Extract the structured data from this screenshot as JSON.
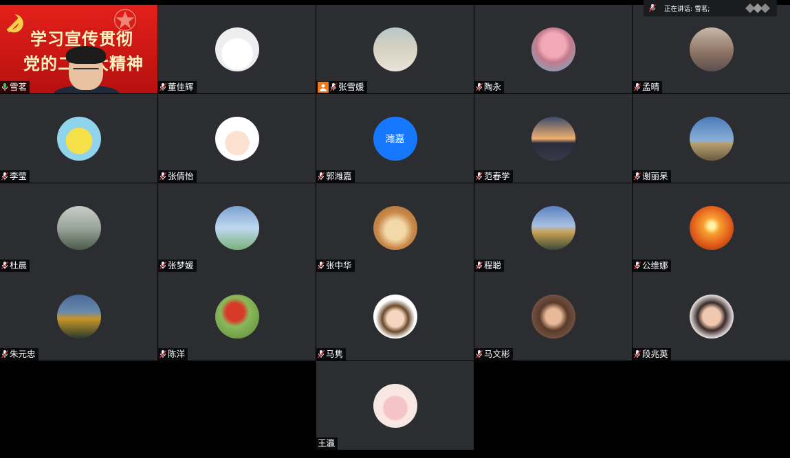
{
  "speaking": {
    "label": "正在讲话: 雪茗;"
  },
  "speaker_tile": {
    "name": "雪茗",
    "banner_line1": "学习宣传贯彻",
    "banner_line2": "党的二十大精神"
  },
  "participants": [
    {
      "name": "董佳辉",
      "avatar": "snowman-santa-avatar"
    },
    {
      "name": "张雪媛",
      "avatar": "woman-photo-avatar",
      "camera_off": true
    },
    {
      "name": "陶永",
      "avatar": "cherry-blossom-avatar"
    },
    {
      "name": "孟晴",
      "avatar": "street-photo-avatar"
    },
    {
      "name": "李莹",
      "avatar": "spongebob-avatar"
    },
    {
      "name": "张倩怡",
      "avatar": "cartoon-girl-bow-avatar"
    },
    {
      "name": "郭潍嘉",
      "avatar_text": "潍嘉"
    },
    {
      "name": "范春学",
      "avatar": "sunset-city-avatar"
    },
    {
      "name": "谢丽杲",
      "avatar": "beach-flags-avatar"
    },
    {
      "name": "杜晨",
      "avatar": "misty-mountain-avatar"
    },
    {
      "name": "张梦媛",
      "avatar": "heart-frame-avatar"
    },
    {
      "name": "张中华",
      "avatar": "shiba-dog-avatar"
    },
    {
      "name": "程聪",
      "avatar": "pagoda-landscape-avatar"
    },
    {
      "name": "公维娜",
      "avatar": "sunset-sea-avatar"
    },
    {
      "name": "朱元忠",
      "avatar": "pagoda-night-avatar"
    },
    {
      "name": "陈洋",
      "avatar": "mushroom-avatar"
    },
    {
      "name": "马隽",
      "avatar": "anime-girl-avatar"
    },
    {
      "name": "马文彬",
      "avatar": "woman-portrait-avatar"
    },
    {
      "name": "段兆英",
      "avatar": "woman-selfie-avatar"
    },
    {
      "name": "王瀛",
      "avatar": "pig-avatar",
      "no_mic": true
    }
  ],
  "colors": {
    "tile": "#2b2d30",
    "accent": "#1677ff",
    "mic_red": "#e0343a"
  }
}
